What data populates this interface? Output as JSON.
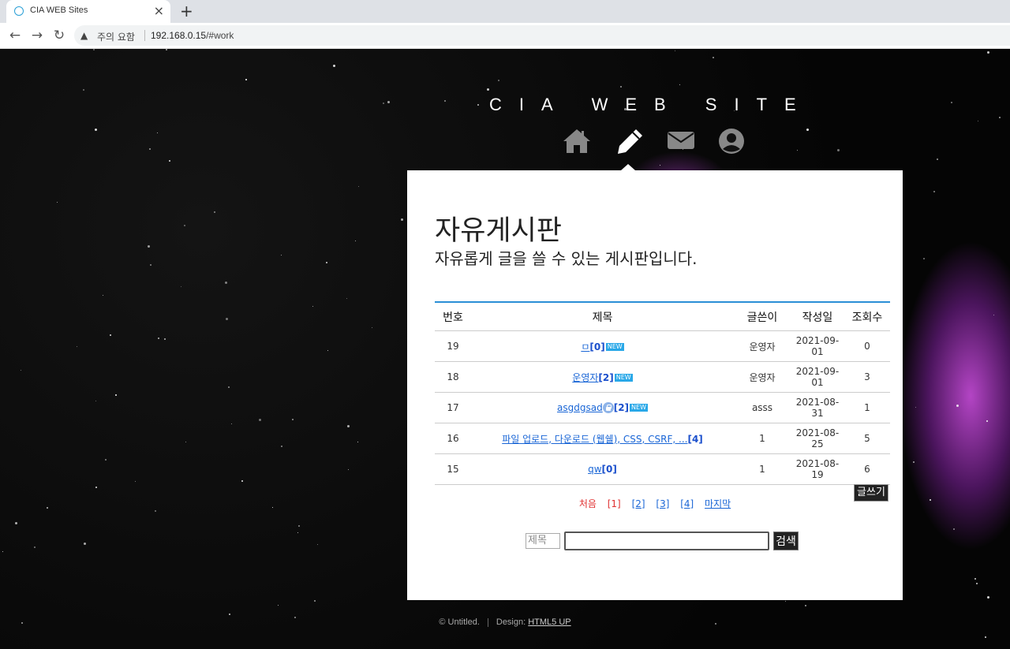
{
  "browser": {
    "tab_title": "CIA WEB Sites",
    "new_tab": "+",
    "tab_close": "×",
    "back": "←",
    "forward": "→",
    "reload": "↻",
    "security_label": "주의 요함",
    "url_host": "192.168.0.15",
    "url_path": "/#work"
  },
  "site": {
    "title": "CIA WEB SITE",
    "nav_icons": [
      "home-icon",
      "pencil-icon",
      "envelope-icon",
      "user-icon"
    ],
    "active_nav": "pencil-icon"
  },
  "board": {
    "title": "자유게시판",
    "subtitle": "자유롭게 글을 쓸 수 있는 게시판입니다.",
    "headers": {
      "num": "번호",
      "subject": "제목",
      "writer": "글쓴이",
      "date": "작성일",
      "views": "조회수"
    },
    "rows": [
      {
        "num": "19",
        "subject": "ㅁ",
        "comments": "[0]",
        "new": "NEW",
        "writer": "운영자",
        "date": "2021-09-01",
        "views": "0"
      },
      {
        "num": "18",
        "subject": "운영자",
        "comments": "[2]",
        "new": "NEW",
        "writer": "운영자",
        "date": "2021-09-01",
        "views": "3"
      },
      {
        "num": "17",
        "subject": "asgdgsad",
        "comments": "[2]",
        "new": "NEW",
        "writer": "asss",
        "date": "2021-08-31",
        "views": "1"
      },
      {
        "num": "16",
        "subject": "파일 업로드, 다운로드 (웹쉘), CSS, CSRF, ...",
        "comments": "[4]",
        "new": "",
        "writer": "1",
        "date": "2021-08-25",
        "views": "5"
      },
      {
        "num": "15",
        "subject": "qw",
        "comments": "[0]",
        "new": "",
        "writer": "1",
        "date": "2021-08-19",
        "views": "6"
      }
    ],
    "write_button": "글쓰기",
    "pager": {
      "first": "처음",
      "current": "[1]",
      "pages": [
        "[2]",
        "[3]",
        "[4]"
      ],
      "last": "마지막"
    },
    "search": {
      "field": "제목",
      "value": "",
      "button": "검색"
    }
  },
  "footer": {
    "copyright": "© Untitled.",
    "design_label": "Design:",
    "design_link": "HTML5 UP"
  },
  "colors": {
    "accent_line": "#2a8fd6",
    "new_badge": "#29a8e8",
    "pager_active": "#e03030",
    "link": "#1a66d6"
  }
}
